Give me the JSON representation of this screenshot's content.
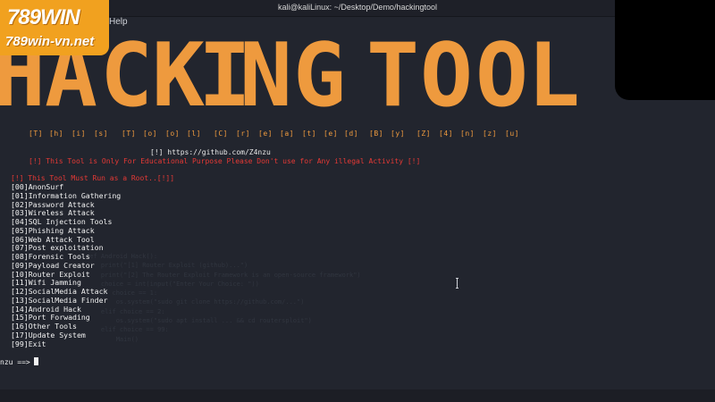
{
  "window": {
    "title": "kali@kaliLinux: ~/Desktop/Demo/hackingtool"
  },
  "menubar": {
    "help": "Help"
  },
  "logo": {
    "top": "789WIN",
    "bottom": "789win-vn.net"
  },
  "banner": {
    "letters": [
      "H",
      "A",
      "C",
      "K",
      "I",
      "N",
      "G",
      "T",
      "O",
      "O",
      "L"
    ],
    "subtitle": [
      "[T]",
      "[h]",
      "[i]",
      "[s]",
      "[T]",
      "[o]",
      "[o]",
      "[l]",
      "[C]",
      "[r]",
      "[e]",
      "[a]",
      "[t]",
      "[e]",
      "[d]",
      "[B]",
      "[y]",
      "[Z]",
      "[4]",
      "[n]",
      "[z]",
      "[u]"
    ]
  },
  "info": {
    "github": "[!] https://github.com/Z4nzu",
    "warning": "[!] This Tool is Only For Educational Purpose Please Don't use for Any illegal Activity [!]",
    "root": "[!] This Tool Must Run as a Root..[!]]"
  },
  "menu": [
    "[00]AnonSurf",
    "[01]Information Gathering",
    "[02]Password Attack",
    "[03]Wireless Attack",
    "[04]SQL Injection Tools",
    "[05]Phishing Attack",
    "[06]Web Attack Tool",
    "[07]Post exploitation",
    "[08]Forensic Tools",
    "[09]Payload Creator",
    "[10]Router Exploit",
    "[11]Wifi Jamming",
    "[12]SocialMedia Attack",
    "[13]SocialMedia Finder",
    "[14]Android Hack",
    "[15]Port Forwading",
    "[16]Other Tools",
    "[17]Update System",
    "[99]Exit"
  ],
  "prompt": {
    "text": "nzu  ==>"
  },
  "colors": {
    "banner": "#ee9a3e",
    "warning": "#e53935",
    "terminal_bg": "#22252e",
    "logo_bg": "#f1a11f"
  }
}
